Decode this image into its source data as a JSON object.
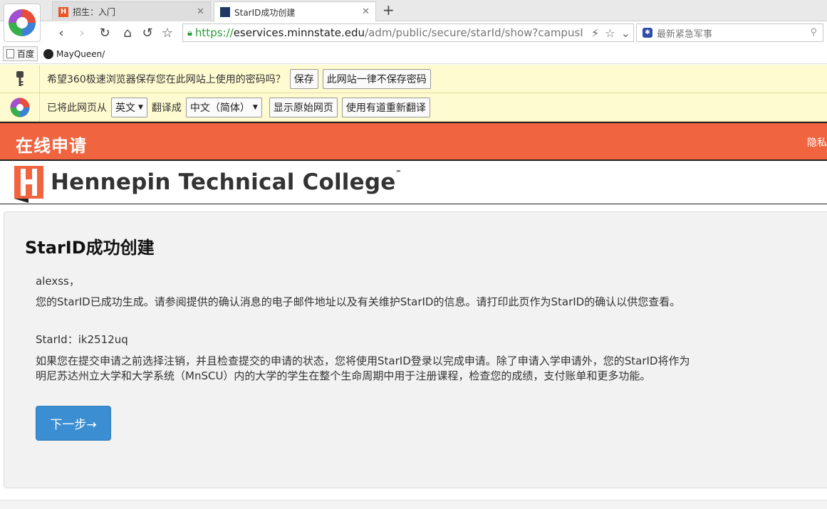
{
  "browser": {
    "tabs": [
      {
        "title": "招生：入门",
        "active": false
      },
      {
        "title": "StarID成功创建",
        "active": true
      }
    ],
    "url": {
      "scheme": "https://",
      "host": "eservices.minnstate.edu",
      "path": "/adm/public/secure/starId/show?campusI"
    },
    "search_placeholder": "最新紧急军事",
    "bookmarks": [
      "百度",
      "MayQueen/"
    ]
  },
  "password_bar": {
    "message": "希望360极速浏览器保存您在此网站上使用的密码吗？",
    "save_label": "保存",
    "never_label": "此网站一律不保存密码"
  },
  "translate_bar": {
    "prefix": "已将此网页从",
    "from_lang": "英文",
    "middle": "翻译成",
    "to_lang": "中文（简体）",
    "show_original": "显示原始网页",
    "retranslate": "使用有道重新翻译"
  },
  "header": {
    "title": "在线申请",
    "right_text": "隐私"
  },
  "brand": {
    "name": "Hennepin Technical College",
    "mark": "℠"
  },
  "content": {
    "heading": "StarID成功创建",
    "greeting": "alexss，",
    "message": "您的StarID已成功生成。请参阅提供的确认消息的电子邮件地址以及有关维护StarID的信息。请打印此页作为StarID的确认以供您查看。",
    "starid_label": "StarId：",
    "starid_value": "ik2512uq",
    "info_line1": "如果您在提交申请之前选择注销，并且检查提交的申请的状态，您将使用StarID登录以完成申请。除了申请入学申请外，您的StarID将作为",
    "info_line2": "明尼苏达州立大学和大学系统（MnSCU）内的大学的学生在整个生命周期中用于注册课程，检查您的成绩，支付账单和更多功能。",
    "next_button": "下一步→"
  },
  "colors": {
    "header_bg": "#f06440",
    "button_bg": "#3b8ed1",
    "infobar_bg": "#fffbd0"
  }
}
